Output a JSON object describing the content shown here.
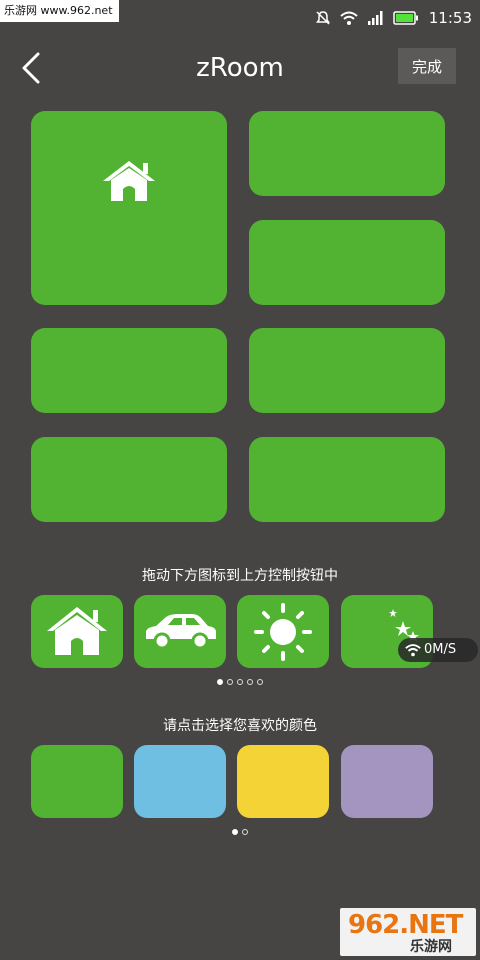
{
  "status_bar": {
    "watermark": "乐游网 www.962.net",
    "time": "11:53",
    "icons": [
      "mute-icon",
      "wifi-icon",
      "signal-icon",
      "battery-icon"
    ]
  },
  "header": {
    "back_icon": "chevron-left-icon",
    "title": "zRoom",
    "done_label": "完成"
  },
  "control_grid": {
    "tiles": [
      {
        "icon": "home-icon"
      },
      {
        "icon": ""
      },
      {
        "icon": ""
      },
      {
        "icon": ""
      },
      {
        "icon": ""
      },
      {
        "icon": ""
      },
      {
        "icon": ""
      }
    ]
  },
  "icon_picker": {
    "hint": "拖动下方图标到上方控制按钮中",
    "icons": [
      "home-icon",
      "car-icon",
      "sun-icon",
      "moon-stars-icon"
    ],
    "page_count": 5,
    "active_page": 0
  },
  "color_picker": {
    "hint": "请点击选择您喜欢的颜色",
    "colors": [
      "#52b332",
      "#6ebfe2",
      "#f3d335",
      "#a494c0"
    ],
    "page_count": 2,
    "active_page": 0
  },
  "network_speed": {
    "value": "0M/S"
  },
  "watermark_bottom": {
    "brand": "962.NET",
    "name": "乐游网"
  },
  "colors": {
    "background": "#464543",
    "tile": "#52b332"
  }
}
